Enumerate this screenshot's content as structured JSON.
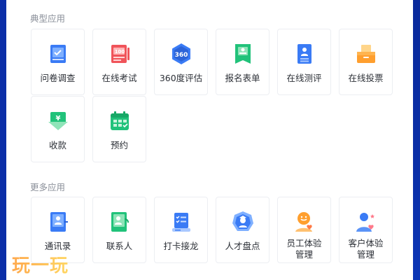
{
  "sections": {
    "typical": {
      "title": "典型应用",
      "items": [
        {
          "label": "问卷调查",
          "icon": "questionnaire-icon"
        },
        {
          "label": "在线考试",
          "icon": "exam-paper-icon"
        },
        {
          "label": "360度评估",
          "icon": "hexagon-360-icon",
          "badge": "360"
        },
        {
          "label": "报名表单",
          "icon": "registration-form-icon"
        },
        {
          "label": "在线测评",
          "icon": "profile-test-icon"
        },
        {
          "label": "在线投票",
          "icon": "ballot-box-icon"
        },
        {
          "label": "收款",
          "icon": "payment-yen-icon",
          "badge": "¥"
        },
        {
          "label": "预约",
          "icon": "calendar-icon"
        }
      ]
    },
    "more": {
      "title": "更多应用",
      "items": [
        {
          "label": "通讯录",
          "icon": "address-book-icon"
        },
        {
          "label": "联系人",
          "icon": "contact-phone-icon"
        },
        {
          "label": "打卡接龙",
          "icon": "checkin-list-icon"
        },
        {
          "label": "人才盘点",
          "icon": "talent-badge-icon"
        },
        {
          "label_lines": [
            "员工体验",
            "管理"
          ],
          "icon": "employee-experience-icon"
        },
        {
          "label_lines": [
            "客户体验",
            "管理"
          ],
          "icon": "customer-experience-icon"
        }
      ]
    }
  },
  "watermark": "玩一玩",
  "colors": {
    "page_bg": "#0b2fa8",
    "panel_bg": "#ffffff",
    "blue": "#3a7bf5",
    "red": "#f0545a",
    "green": "#21c27a",
    "orange": "#ff9f2e"
  }
}
